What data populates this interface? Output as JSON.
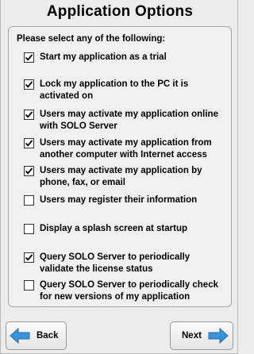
{
  "title": "Application Options",
  "prompt": "Please select any of the following:",
  "options": [
    {
      "label": "Start my application as a trial",
      "checked": true
    },
    {
      "label": "Lock my application to the PC it is activated on",
      "checked": true
    },
    {
      "label": "Users may activate my application online with SOLO Server",
      "checked": true
    },
    {
      "label": "Users may activate my application from another computer with Internet access",
      "checked": true
    },
    {
      "label": "Users may activate my application by phone, fax, or email",
      "checked": true
    },
    {
      "label": "Users may register their information",
      "checked": false
    },
    {
      "label": "Display a splash screen at startup",
      "checked": false
    },
    {
      "label": "Query SOLO Server to periodically validate the license status",
      "checked": true
    },
    {
      "label": "Query SOLO Server to periodically check for new versions of my application",
      "checked": false
    }
  ],
  "buttons": {
    "back": {
      "label": "Back",
      "icon": "left-arrow-icon"
    },
    "next": {
      "label": "Next",
      "icon": "right-arrow-icon"
    }
  },
  "colors": {
    "arrow": "#3a93d8",
    "check": "#000000"
  }
}
